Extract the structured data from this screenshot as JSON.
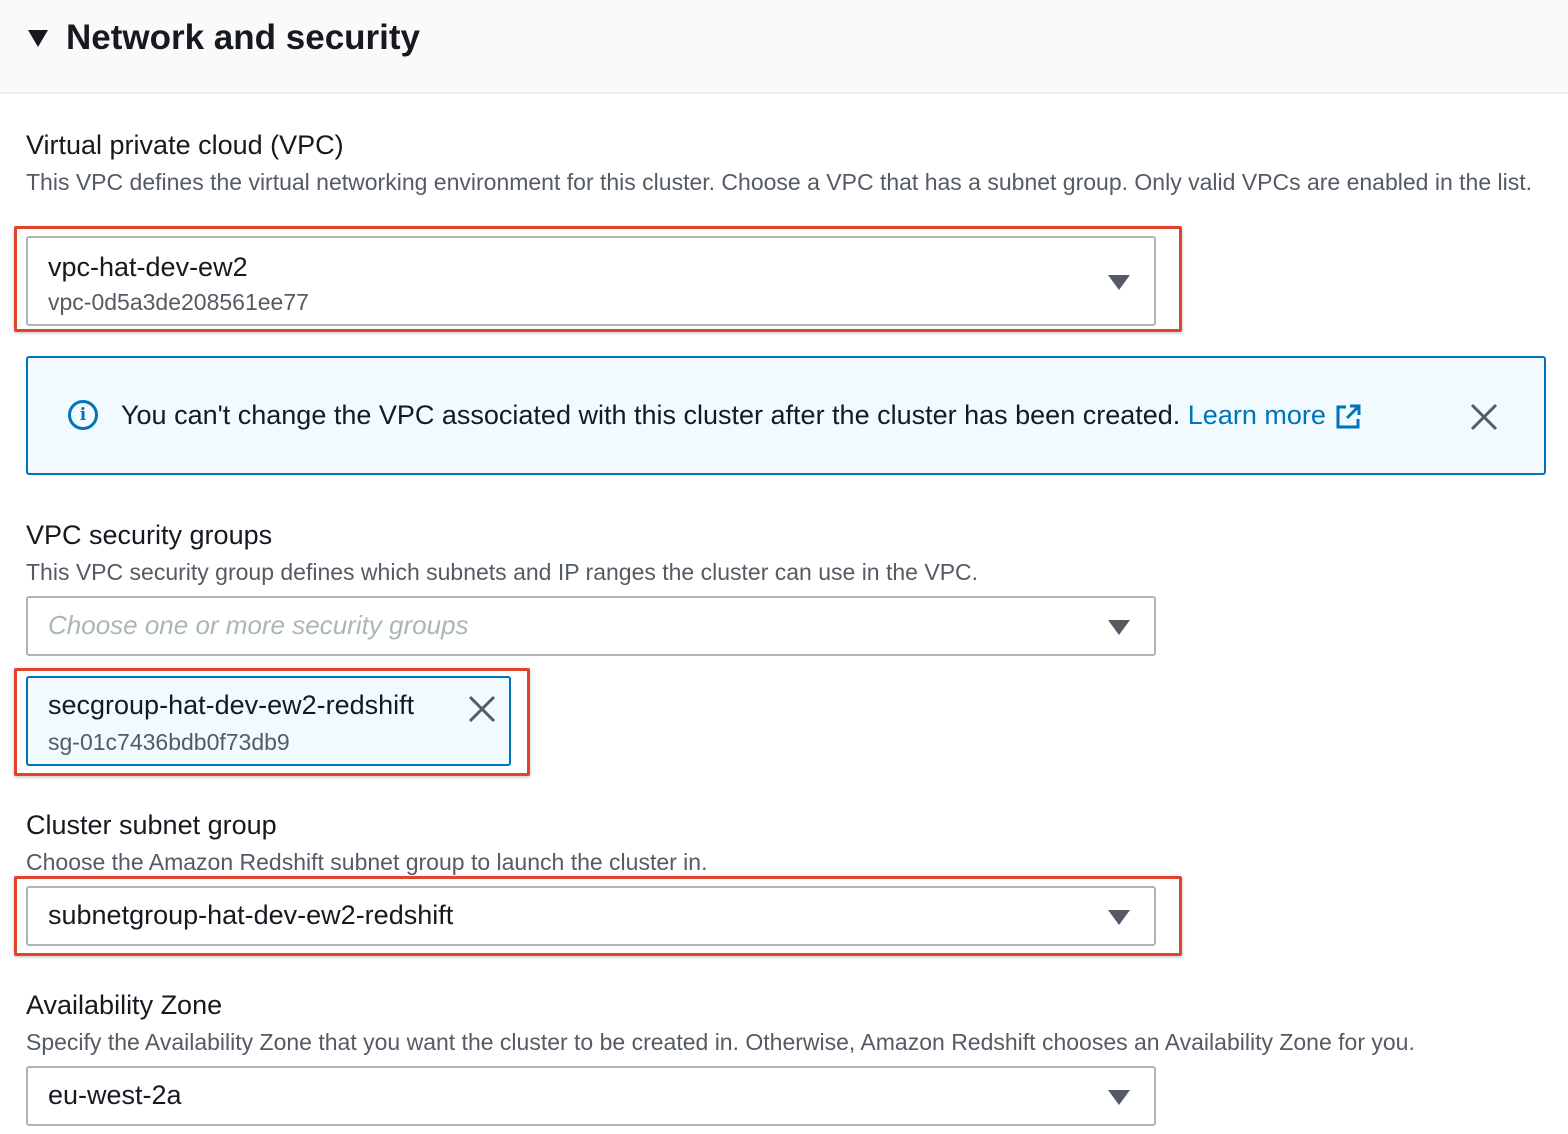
{
  "section": {
    "title": "Network and security"
  },
  "vpc": {
    "label": "Virtual private cloud (VPC)",
    "description": "This VPC defines the virtual networking environment for this cluster. Choose a VPC that has a subnet group. Only valid VPCs are enabled in the list.",
    "selected_name": "vpc-hat-dev-ew2",
    "selected_id": "vpc-0d5a3de208561ee77"
  },
  "alert": {
    "message": "You can't change the VPC associated with this cluster after the cluster has been created. ",
    "link_text": "Learn more"
  },
  "security_groups": {
    "label": "VPC security groups",
    "description": "This VPC security group defines which subnets and IP ranges the cluster can use in the VPC.",
    "placeholder": "Choose one or more security groups",
    "token_name": "secgroup-hat-dev-ew2-redshift",
    "token_id": "sg-01c7436bdb0f73db9"
  },
  "subnet_group": {
    "label": "Cluster subnet group",
    "description": "Choose the Amazon Redshift subnet group to launch the cluster in.",
    "selected": "subnetgroup-hat-dev-ew2-redshift"
  },
  "availability_zone": {
    "label": "Availability Zone",
    "description": "Specify the Availability Zone that you want the cluster to be created in. Otherwise, Amazon Redshift chooses an Availability Zone for you.",
    "selected": "eu-west-2a"
  },
  "colors": {
    "accent": "#0073bb",
    "highlight_border": "#e0442f",
    "alert_background": "#f1faff"
  },
  "icons": [
    "caret-down-icon",
    "dropdown-arrow-icon",
    "info-icon",
    "external-link-icon",
    "close-icon"
  ]
}
